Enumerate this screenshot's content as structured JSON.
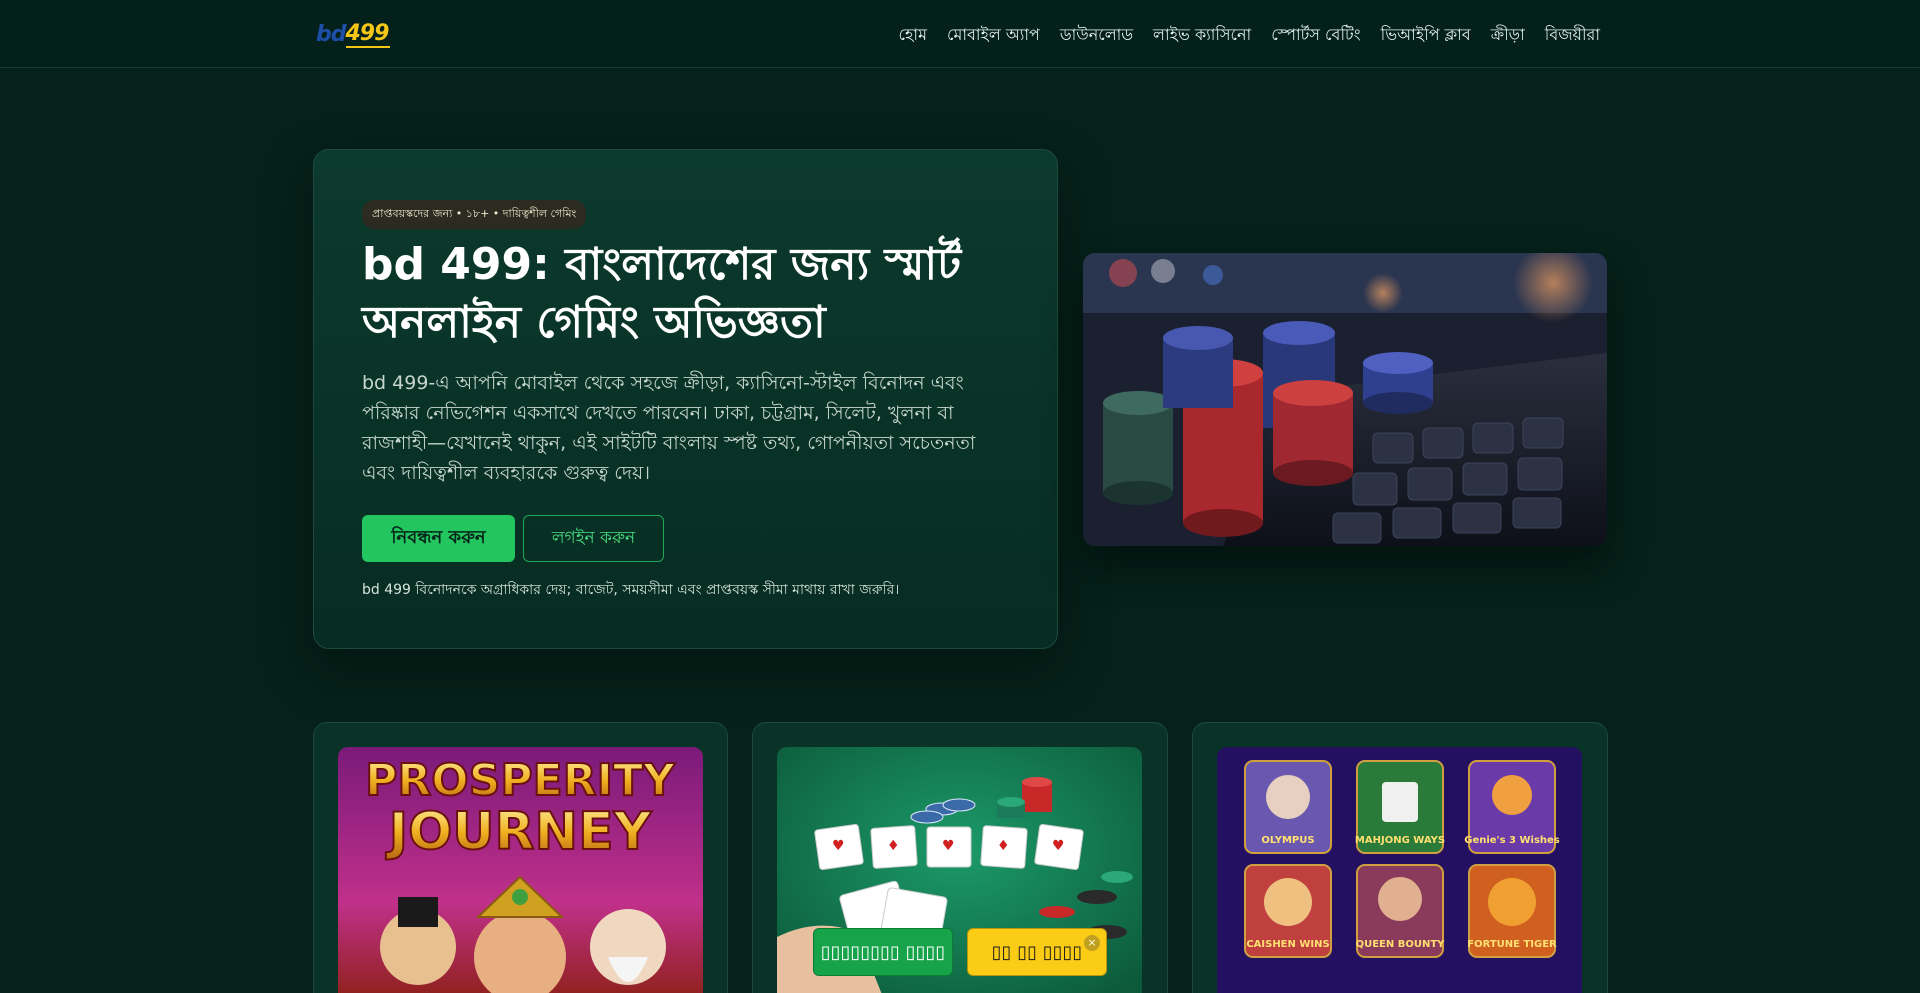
{
  "header": {
    "logo_prefix": "bd",
    "logo_number": "499",
    "nav": [
      "হোম",
      "মোবাইল অ্যাপ",
      "ডাউনলোড",
      "লাইভ ক্যাসিনো",
      "স্পোর্টস বেটিং",
      "ভিআইপি ক্লাব",
      "ক্রীড়া",
      "বিজয়ীরা"
    ]
  },
  "hero": {
    "badge": "প্রাপ্তবয়স্কদের জন্য • ১৮+ • দায়িত্বশীল গেমিং",
    "title": "bd 499: বাংলাদেশের জন্য স্মার্ট অনলাইন গেমিং অভিজ্ঞতা",
    "description": "bd 499-এ আপনি মোবাইল থেকে সহজে ক্রীড়া, ক্যাসিনো-স্টাইল বিনোদন এবং পরিষ্কার নেভিগেশন একসাথে দেখতে পারবেন। ঢাকা, চট্টগ্রাম, সিলেট, খুলনা বা রাজশাহী—যেখানেই থাকুন, এই সাইটটি বাংলায় স্পষ্ট তথ্য, গোপনীয়তা সচেতনতা এবং দায়িত্বশীল ব্যবহারকে গুরুত্ব দেয়।",
    "register_label": "নিবন্ধন করুন",
    "login_label": "লগইন করুন",
    "note": "bd 499 বিনোদনকে অগ্রাধিকার দেয়; বাজেট, সময়সীমা এবং প্রাপ্তবয়স্ক সীমা মাথায় রাখা জরুরি।"
  },
  "cards": [
    {
      "image_text": [
        "PROSPERITY",
        "JOURNEY"
      ]
    },
    {
      "image_text": []
    },
    {
      "image_text": [
        "OLYMPUS",
        "MAHJONG WAYS",
        "Genie's 3 Wishes",
        "CAISHEN WINS",
        "QUEEN BOUNTY",
        "FORTUNE TIGER"
      ]
    }
  ],
  "sticky": {
    "left_label": "▯▯▯▯▯▯▯▯ ▯▯▯▯",
    "right_label": "▯▯ ▯▯ ▯▯▯▯",
    "close_icon": "×"
  },
  "colors": {
    "background": "#052119",
    "accent_green": "#22c55e",
    "accent_yellow": "#facc15",
    "logo_blue": "#1e4fa8",
    "logo_yellow": "#f5c518"
  }
}
